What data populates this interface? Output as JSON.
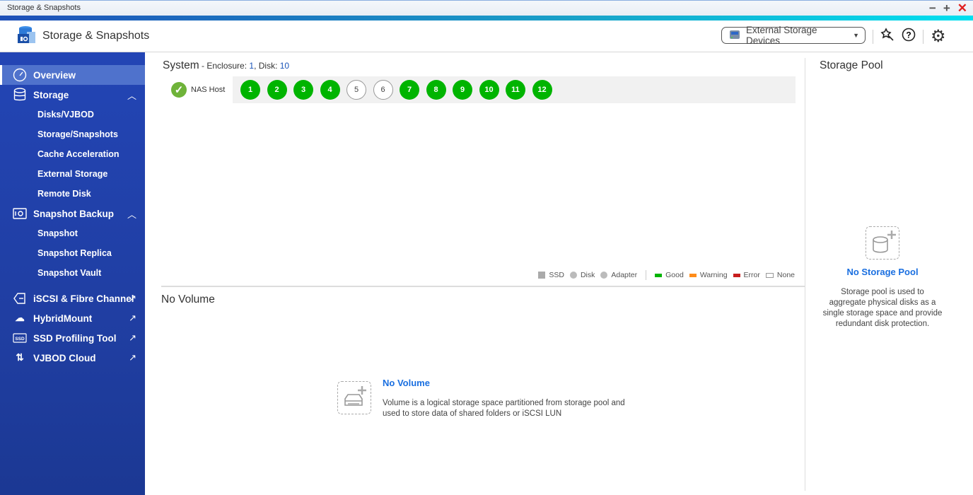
{
  "window": {
    "title": "Storage & Snapshots",
    "controls": [
      "−",
      "+",
      "✕"
    ]
  },
  "header": {
    "app_title": "Storage & Snapshots",
    "external_devices_label": "External Storage Devices"
  },
  "sidebar": {
    "overview": "Overview",
    "storage": {
      "label": "Storage",
      "items": [
        "Disks/VJBOD",
        "Storage/Snapshots",
        "Cache Acceleration",
        "External Storage",
        "Remote Disk"
      ]
    },
    "snapshot_backup": {
      "label": "Snapshot Backup",
      "items": [
        "Snapshot",
        "Snapshot Replica",
        "Snapshot Vault"
      ]
    },
    "external_links": [
      "iSCSI & Fibre Channel",
      "HybridMount",
      "SSD Profiling Tool",
      "VJBOD Cloud"
    ]
  },
  "system": {
    "title": "System",
    "enclosure_label": " - Enclosure: ",
    "enclosure": "1",
    "disk_label": ", Disk: ",
    "disk": "10",
    "nas_host": "NAS Host",
    "slots": [
      {
        "n": "1",
        "s": "good"
      },
      {
        "n": "2",
        "s": "good"
      },
      {
        "n": "3",
        "s": "good"
      },
      {
        "n": "4",
        "s": "good"
      },
      {
        "n": "5",
        "s": "empty"
      },
      {
        "n": "6",
        "s": "empty"
      },
      {
        "n": "7",
        "s": "good"
      },
      {
        "n": "8",
        "s": "good"
      },
      {
        "n": "9",
        "s": "good"
      },
      {
        "n": "10",
        "s": "good"
      },
      {
        "n": "11",
        "s": "good"
      },
      {
        "n": "12",
        "s": "good"
      }
    ]
  },
  "legend": {
    "ssd": "SSD",
    "disk": "Disk",
    "adapter": "Adapter",
    "good": "Good",
    "warning": "Warning",
    "error": "Error",
    "none": "None",
    "colors": {
      "good": "#00b400",
      "warning": "#ff8c1a",
      "error": "#c81e1e"
    }
  },
  "volume": {
    "section_title": "No Volume",
    "heading": "No Volume",
    "description": "Volume is a logical storage space partitioned from storage pool and used to store data of shared folders or iSCSI LUN"
  },
  "storage_pool": {
    "title": "Storage Pool",
    "heading": "No Storage Pool",
    "description": "Storage pool is used to aggregate physical disks as a single storage space and provide redundant disk protection."
  }
}
